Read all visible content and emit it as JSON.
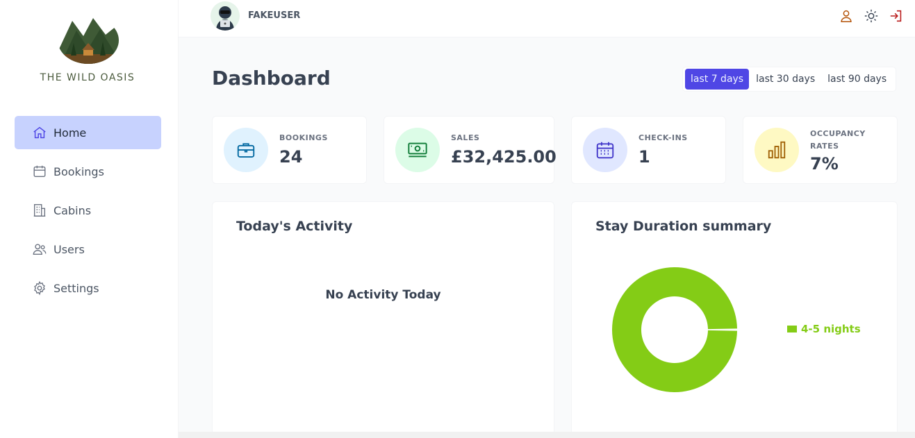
{
  "brand": {
    "name": "THE WILD OASIS"
  },
  "sidebar": {
    "items": [
      {
        "label": "Home",
        "icon": "home-icon",
        "active": true
      },
      {
        "label": "Bookings",
        "icon": "calendar-icon"
      },
      {
        "label": "Cabins",
        "icon": "building-icon"
      },
      {
        "label": "Users",
        "icon": "users-icon"
      },
      {
        "label": "Settings",
        "icon": "gear-icon"
      }
    ]
  },
  "header": {
    "username": "FAKEUSER",
    "icons": [
      "user-icon",
      "sun-icon",
      "logout-icon"
    ]
  },
  "page": {
    "title": "Dashboard"
  },
  "filter": {
    "options": [
      "last 7 days",
      "last 30 days",
      "last 90 days"
    ],
    "selected": "last 7 days"
  },
  "stats": [
    {
      "label": "BOOKINGS",
      "value": "24",
      "icon": "briefcase-icon",
      "color": "#0369a1",
      "bg": "#e0f2fe"
    },
    {
      "label": "SALES",
      "value": "£32,425.00",
      "icon": "banknotes-icon",
      "color": "#15803d",
      "bg": "#dcfce7"
    },
    {
      "label": "CHECK-INS",
      "value": "1",
      "icon": "calendar-days-icon",
      "color": "#4338ca",
      "bg": "#e0e7ff"
    },
    {
      "label": "OCCUPANCY RATES",
      "value": "7%",
      "icon": "chart-bar-icon",
      "color": "#a16207",
      "bg": "#fef9c3"
    }
  ],
  "activity": {
    "title": "Today's Activity",
    "empty": "No Activity Today"
  },
  "duration": {
    "title": "Stay Duration summary",
    "legend": [
      {
        "label": "4-5 nights",
        "color": "#84cc16"
      }
    ]
  },
  "chart_data": {
    "type": "pie",
    "categories": [
      "4-5 nights"
    ],
    "values": [
      1
    ],
    "colors": [
      "#84cc16"
    ],
    "legend_position": "right"
  }
}
